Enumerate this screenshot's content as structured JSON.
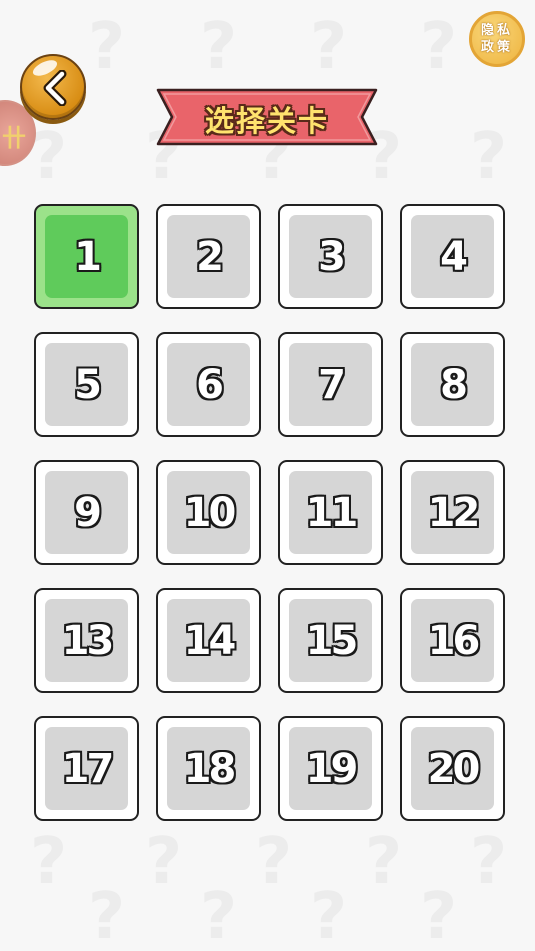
{
  "header": {
    "title": "选择关卡",
    "back_icon": "chevron-left-icon",
    "privacy_label": "隐私政策"
  },
  "levels": {
    "current": 1,
    "items": [
      {
        "label": "1",
        "state": "current"
      },
      {
        "label": "2",
        "state": "locked"
      },
      {
        "label": "3",
        "state": "locked"
      },
      {
        "label": "4",
        "state": "locked"
      },
      {
        "label": "5",
        "state": "locked"
      },
      {
        "label": "6",
        "state": "locked"
      },
      {
        "label": "7",
        "state": "locked"
      },
      {
        "label": "8",
        "state": "locked"
      },
      {
        "label": "9",
        "state": "locked"
      },
      {
        "label": "10",
        "state": "locked"
      },
      {
        "label": "11",
        "state": "locked"
      },
      {
        "label": "12",
        "state": "locked"
      },
      {
        "label": "13",
        "state": "locked"
      },
      {
        "label": "14",
        "state": "locked"
      },
      {
        "label": "15",
        "state": "locked"
      },
      {
        "label": "16",
        "state": "locked"
      },
      {
        "label": "17",
        "state": "locked"
      },
      {
        "label": "18",
        "state": "locked"
      },
      {
        "label": "19",
        "state": "locked"
      },
      {
        "label": "20",
        "state": "locked"
      }
    ]
  },
  "colors": {
    "banner_red": "#e9646a",
    "title_yellow": "#ffe36e",
    "current_green": "#5fcb5b",
    "locked_gray": "#d6d6d6",
    "back_orange": "#e39a22",
    "privacy_gold": "#f2bd49"
  }
}
